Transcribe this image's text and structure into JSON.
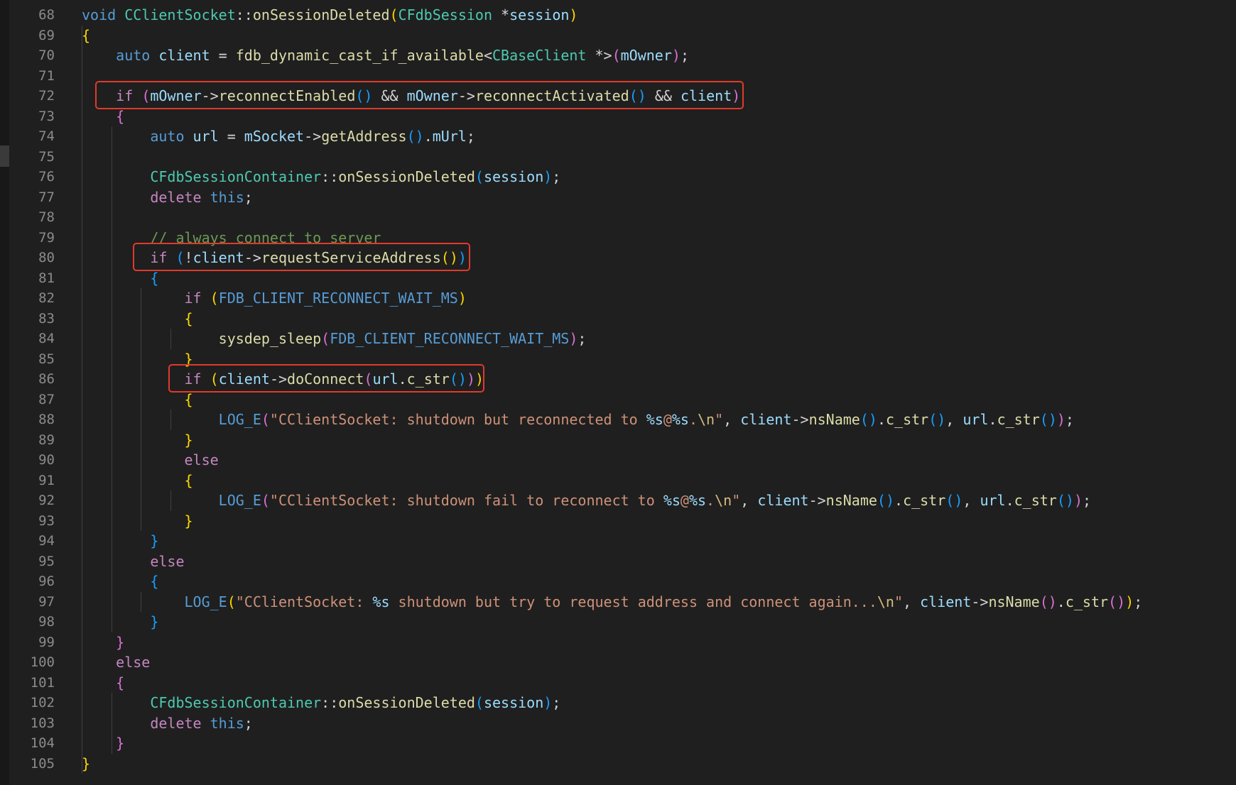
{
  "colors": {
    "background": "#1f1f1f",
    "line_number": "#8b8b8b",
    "highlight_box": "#e03a2a",
    "keyword": "#569cd6",
    "control": "#c586c0",
    "type": "#4ec9b0",
    "function": "#dcdcaa",
    "variable": "#9cdcfe",
    "string": "#ce9178",
    "comment": "#6a9955"
  },
  "first_line_number": 68,
  "highlighted_lines": [
    72,
    80,
    86
  ],
  "lines": [
    [
      [
        "void",
        "kw"
      ],
      [
        " ",
        ""
      ],
      [
        "CClientSocket",
        "ty"
      ],
      [
        "::",
        "op"
      ],
      [
        "onSessionDeleted",
        "fn"
      ],
      [
        "(",
        "b1"
      ],
      [
        "CFdbSession",
        "ty"
      ],
      [
        " *",
        "op"
      ],
      [
        "session",
        "var"
      ],
      [
        ")",
        "b1"
      ]
    ],
    [
      [
        "{",
        "b1"
      ]
    ],
    [
      [
        "    ",
        ""
      ],
      [
        "auto",
        "kw"
      ],
      [
        " ",
        ""
      ],
      [
        "client",
        "var"
      ],
      [
        " = ",
        "op"
      ],
      [
        "fdb_dynamic_cast_if_available",
        "fn"
      ],
      [
        "<",
        "op"
      ],
      [
        "CBaseClient",
        "ty"
      ],
      [
        " *>",
        "op"
      ],
      [
        "(",
        "b2"
      ],
      [
        "mOwner",
        "var"
      ],
      [
        ")",
        "b2"
      ],
      [
        ";",
        "op"
      ]
    ],
    [],
    [
      [
        "    ",
        ""
      ],
      [
        "if",
        "ctl"
      ],
      [
        " ",
        ""
      ],
      [
        "(",
        "b2"
      ],
      [
        "mOwner",
        "var"
      ],
      [
        "->",
        "op"
      ],
      [
        "reconnectEnabled",
        "fn"
      ],
      [
        "()",
        "b3"
      ],
      [
        " && ",
        "op"
      ],
      [
        "mOwner",
        "var"
      ],
      [
        "->",
        "op"
      ],
      [
        "reconnectActivated",
        "fn"
      ],
      [
        "()",
        "b3"
      ],
      [
        " && ",
        "op"
      ],
      [
        "client",
        "var"
      ],
      [
        ")",
        "b2"
      ]
    ],
    [
      [
        "    ",
        ""
      ],
      [
        "{",
        "b2"
      ]
    ],
    [
      [
        "        ",
        ""
      ],
      [
        "auto",
        "kw"
      ],
      [
        " ",
        ""
      ],
      [
        "url",
        "var"
      ],
      [
        " = ",
        "op"
      ],
      [
        "mSocket",
        "var"
      ],
      [
        "->",
        "op"
      ],
      [
        "getAddress",
        "fn"
      ],
      [
        "()",
        "b3"
      ],
      [
        ".",
        "op"
      ],
      [
        "mUrl",
        "var"
      ],
      [
        ";",
        "op"
      ]
    ],
    [],
    [
      [
        "        ",
        ""
      ],
      [
        "CFdbSessionContainer",
        "ty"
      ],
      [
        "::",
        "op"
      ],
      [
        "onSessionDeleted",
        "fn"
      ],
      [
        "(",
        "b3"
      ],
      [
        "session",
        "var"
      ],
      [
        ")",
        "b3"
      ],
      [
        ";",
        "op"
      ]
    ],
    [
      [
        "        ",
        ""
      ],
      [
        "delete",
        "ctl"
      ],
      [
        " ",
        ""
      ],
      [
        "this",
        "kw"
      ],
      [
        ";",
        "op"
      ]
    ],
    [],
    [
      [
        "        ",
        ""
      ],
      [
        "// always connect to server",
        "cmt"
      ]
    ],
    [
      [
        "        ",
        ""
      ],
      [
        "if",
        "ctl"
      ],
      [
        " ",
        ""
      ],
      [
        "(",
        "b3"
      ],
      [
        "!",
        "op"
      ],
      [
        "client",
        "var"
      ],
      [
        "->",
        "op"
      ],
      [
        "requestServiceAddress",
        "fn"
      ],
      [
        "()",
        "b1"
      ],
      [
        ")",
        "b3"
      ]
    ],
    [
      [
        "        ",
        ""
      ],
      [
        "{",
        "b3"
      ]
    ],
    [
      [
        "            ",
        ""
      ],
      [
        "if",
        "ctl"
      ],
      [
        " ",
        ""
      ],
      [
        "(",
        "b1"
      ],
      [
        "FDB_CLIENT_RECONNECT_WAIT_MS",
        "kw"
      ],
      [
        ")",
        "b1"
      ]
    ],
    [
      [
        "            ",
        ""
      ],
      [
        "{",
        "b1"
      ]
    ],
    [
      [
        "                ",
        ""
      ],
      [
        "sysdep_sleep",
        "fn"
      ],
      [
        "(",
        "b2"
      ],
      [
        "FDB_CLIENT_RECONNECT_WAIT_MS",
        "kw"
      ],
      [
        ")",
        "b2"
      ],
      [
        ";",
        "op"
      ]
    ],
    [
      [
        "            ",
        ""
      ],
      [
        "}",
        "b1"
      ]
    ],
    [
      [
        "            ",
        ""
      ],
      [
        "if",
        "ctl"
      ],
      [
        " ",
        ""
      ],
      [
        "(",
        "b1"
      ],
      [
        "client",
        "var"
      ],
      [
        "->",
        "op"
      ],
      [
        "doConnect",
        "fn"
      ],
      [
        "(",
        "b2"
      ],
      [
        "url",
        "var"
      ],
      [
        ".",
        "op"
      ],
      [
        "c_str",
        "fn"
      ],
      [
        "()",
        "b3"
      ],
      [
        ")",
        "b2"
      ],
      [
        ")",
        "b1"
      ]
    ],
    [
      [
        "            ",
        ""
      ],
      [
        "{",
        "b1"
      ]
    ],
    [
      [
        "                ",
        ""
      ],
      [
        "LOG_E",
        "kw"
      ],
      [
        "(",
        "b2"
      ],
      [
        "\"CClientSocket: shutdown but reconnected to ",
        "str"
      ],
      [
        "%s",
        "fmt"
      ],
      [
        "@",
        "str"
      ],
      [
        "%s",
        "fmt"
      ],
      [
        ".",
        "str"
      ],
      [
        "\\n",
        "esc"
      ],
      [
        "\"",
        "str"
      ],
      [
        ", ",
        "op"
      ],
      [
        "client",
        "var"
      ],
      [
        "->",
        "op"
      ],
      [
        "nsName",
        "fn"
      ],
      [
        "()",
        "b3"
      ],
      [
        ".",
        "op"
      ],
      [
        "c_str",
        "fn"
      ],
      [
        "()",
        "b3"
      ],
      [
        ", ",
        "op"
      ],
      [
        "url",
        "var"
      ],
      [
        ".",
        "op"
      ],
      [
        "c_str",
        "fn"
      ],
      [
        "()",
        "b3"
      ],
      [
        ")",
        "b2"
      ],
      [
        ";",
        "op"
      ]
    ],
    [
      [
        "            ",
        ""
      ],
      [
        "}",
        "b1"
      ]
    ],
    [
      [
        "            ",
        ""
      ],
      [
        "else",
        "ctl"
      ]
    ],
    [
      [
        "            ",
        ""
      ],
      [
        "{",
        "b1"
      ]
    ],
    [
      [
        "                ",
        ""
      ],
      [
        "LOG_E",
        "kw"
      ],
      [
        "(",
        "b2"
      ],
      [
        "\"CClientSocket: shutdown fail to reconnect to ",
        "str"
      ],
      [
        "%s",
        "fmt"
      ],
      [
        "@",
        "str"
      ],
      [
        "%s",
        "fmt"
      ],
      [
        ".",
        "str"
      ],
      [
        "\\n",
        "esc"
      ],
      [
        "\"",
        "str"
      ],
      [
        ", ",
        "op"
      ],
      [
        "client",
        "var"
      ],
      [
        "->",
        "op"
      ],
      [
        "nsName",
        "fn"
      ],
      [
        "()",
        "b3"
      ],
      [
        ".",
        "op"
      ],
      [
        "c_str",
        "fn"
      ],
      [
        "()",
        "b3"
      ],
      [
        ", ",
        "op"
      ],
      [
        "url",
        "var"
      ],
      [
        ".",
        "op"
      ],
      [
        "c_str",
        "fn"
      ],
      [
        "()",
        "b3"
      ],
      [
        ")",
        "b2"
      ],
      [
        ";",
        "op"
      ]
    ],
    [
      [
        "            ",
        ""
      ],
      [
        "}",
        "b1"
      ]
    ],
    [
      [
        "        ",
        ""
      ],
      [
        "}",
        "b3"
      ]
    ],
    [
      [
        "        ",
        ""
      ],
      [
        "else",
        "ctl"
      ]
    ],
    [
      [
        "        ",
        ""
      ],
      [
        "{",
        "b3"
      ]
    ],
    [
      [
        "            ",
        ""
      ],
      [
        "LOG_E",
        "kw"
      ],
      [
        "(",
        "b1"
      ],
      [
        "\"CClientSocket: ",
        "str"
      ],
      [
        "%s",
        "fmt"
      ],
      [
        " shutdown but try to request address and connect again...",
        "str"
      ],
      [
        "\\n",
        "esc"
      ],
      [
        "\"",
        "str"
      ],
      [
        ", ",
        "op"
      ],
      [
        "client",
        "var"
      ],
      [
        "->",
        "op"
      ],
      [
        "nsName",
        "fn"
      ],
      [
        "()",
        "b2"
      ],
      [
        ".",
        "op"
      ],
      [
        "c_str",
        "fn"
      ],
      [
        "()",
        "b2"
      ],
      [
        ")",
        "b1"
      ],
      [
        ";",
        "op"
      ]
    ],
    [
      [
        "        ",
        ""
      ],
      [
        "}",
        "b3"
      ]
    ],
    [
      [
        "    ",
        ""
      ],
      [
        "}",
        "b2"
      ]
    ],
    [
      [
        "    ",
        ""
      ],
      [
        "else",
        "ctl"
      ]
    ],
    [
      [
        "    ",
        ""
      ],
      [
        "{",
        "b2"
      ]
    ],
    [
      [
        "        ",
        ""
      ],
      [
        "CFdbSessionContainer",
        "ty"
      ],
      [
        "::",
        "op"
      ],
      [
        "onSessionDeleted",
        "fn"
      ],
      [
        "(",
        "b3"
      ],
      [
        "session",
        "var"
      ],
      [
        ")",
        "b3"
      ],
      [
        ";",
        "op"
      ]
    ],
    [
      [
        "        ",
        ""
      ],
      [
        "delete",
        "ctl"
      ],
      [
        " ",
        ""
      ],
      [
        "this",
        "kw"
      ],
      [
        ";",
        "op"
      ]
    ],
    [
      [
        "    ",
        ""
      ],
      [
        "}",
        "b2"
      ]
    ],
    [
      [
        "}",
        "b1"
      ]
    ]
  ]
}
